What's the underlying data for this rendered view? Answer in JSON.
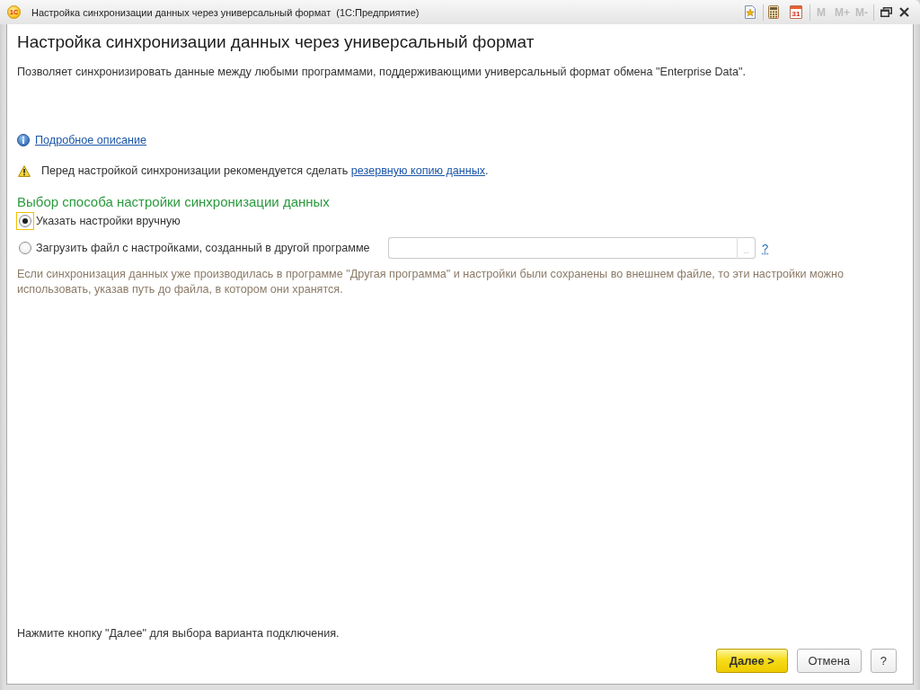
{
  "window": {
    "logo": "1С",
    "title": "Настройка синхронизации данных через универсальный формат  (1С:Предприятие)"
  },
  "toolbar": {
    "calendar_label": "31",
    "memory_buttons": [
      {
        "label": "M",
        "disabled": true
      },
      {
        "label": "M+",
        "disabled": true
      },
      {
        "label": "M-",
        "disabled": true
      }
    ]
  },
  "form": {
    "heading": "Настройка синхронизации данных через универсальный формат",
    "description": "Позволяет синхронизировать данные между любыми программами, поддерживающими универсальный формат обмена \"Enterprise Data\".",
    "details_link": "Подробное описание",
    "warning": {
      "before": "Перед настройкой синхронизации рекомендуется сделать",
      "link": "резервную копию данных",
      "after": "."
    },
    "section_title": "Выбор способа настройки синхронизации данных",
    "options": [
      {
        "kind": "plain",
        "label": "Указать настройки вручную",
        "selected": true,
        "focused": true
      },
      {
        "kind": "file",
        "label": "Загрузить файл с настройками, созданный в другой программе",
        "selected": false,
        "focused": false,
        "choose_button": "...",
        "help_link": "?"
      }
    ],
    "note": "Если синхронизация данных уже производилась в программе \"Другая программа\" и настройки были сохранены во внешнем файле, то эти настройки можно использовать, указав путь до файла, в котором они хранятся."
  },
  "footer": {
    "hint": "Нажмите кнопку \"Далее\" для выбора варианта подключения.",
    "buttons": [
      {
        "label": "Далее >",
        "kind": "primary"
      },
      {
        "label": "Отмена",
        "kind": "default"
      },
      {
        "label": "?",
        "kind": "default"
      }
    ]
  }
}
